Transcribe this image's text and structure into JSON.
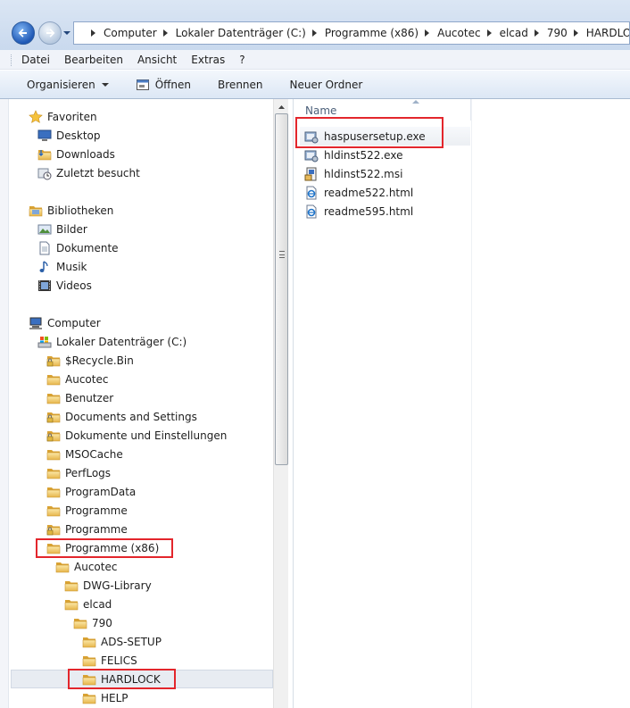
{
  "address": {
    "crumbs": [
      "Computer",
      "Lokaler Datenträger (C:)",
      "Programme (x86)",
      "Aucotec",
      "elcad",
      "790",
      "HARDLOCK"
    ]
  },
  "menu": [
    "Datei",
    "Bearbeiten",
    "Ansicht",
    "Extras",
    "?"
  ],
  "commands": {
    "organize": "Organisieren",
    "open": "Öffnen",
    "burn": "Brennen",
    "new_folder": "Neuer Ordner"
  },
  "tree": [
    {
      "label": "Favoriten",
      "icon": "star-icon"
    },
    {
      "label": "Desktop",
      "icon": "desktop-icon"
    },
    {
      "label": "Downloads",
      "icon": "downloads-folder-icon"
    },
    {
      "label": "Zuletzt besucht",
      "icon": "recent-places-icon"
    },
    {
      "label": "Bibliotheken",
      "icon": "libraries-icon"
    },
    {
      "label": "Bilder",
      "icon": "pictures-icon"
    },
    {
      "label": "Dokumente",
      "icon": "documents-icon"
    },
    {
      "label": "Musik",
      "icon": "music-icon"
    },
    {
      "label": "Videos",
      "icon": "videos-icon"
    },
    {
      "label": "Computer",
      "icon": "computer-icon"
    },
    {
      "label": "Lokaler Datenträger (C:)",
      "icon": "drive-icon"
    },
    {
      "label": "$Recycle.Bin",
      "icon": "locked-folder-icon"
    },
    {
      "label": "Aucotec",
      "icon": "folder-icon"
    },
    {
      "label": "Benutzer",
      "icon": "folder-icon"
    },
    {
      "label": "Documents and Settings",
      "icon": "locked-folder-icon"
    },
    {
      "label": "Dokumente und Einstellungen",
      "icon": "locked-folder-icon"
    },
    {
      "label": "MSOCache",
      "icon": "folder-icon"
    },
    {
      "label": "PerfLogs",
      "icon": "folder-icon"
    },
    {
      "label": "ProgramData",
      "icon": "folder-icon"
    },
    {
      "label": "Programme",
      "icon": "folder-icon"
    },
    {
      "label": "Programme",
      "icon": "locked-folder-icon"
    },
    {
      "label": "Programme (x86)",
      "icon": "folder-icon"
    },
    {
      "label": "Aucotec",
      "icon": "folder-icon"
    },
    {
      "label": "DWG-Library",
      "icon": "folder-icon"
    },
    {
      "label": "elcad",
      "icon": "folder-icon"
    },
    {
      "label": "790",
      "icon": "folder-icon"
    },
    {
      "label": "ADS-SETUP",
      "icon": "folder-icon"
    },
    {
      "label": "FELICS",
      "icon": "folder-icon"
    },
    {
      "label": "HARDLOCK",
      "icon": "folder-icon"
    },
    {
      "label": "HELP",
      "icon": "folder-icon"
    }
  ],
  "files": {
    "column": "Name",
    "items": [
      {
        "name": "haspusersetup.exe",
        "icon": "setup-exe-icon"
      },
      {
        "name": "hldinst522.exe",
        "icon": "setup-exe-icon"
      },
      {
        "name": "hldinst522.msi",
        "icon": "msi-package-icon"
      },
      {
        "name": "readme522.html",
        "icon": "ie-html-icon"
      },
      {
        "name": "readme595.html",
        "icon": "ie-html-icon"
      }
    ]
  }
}
